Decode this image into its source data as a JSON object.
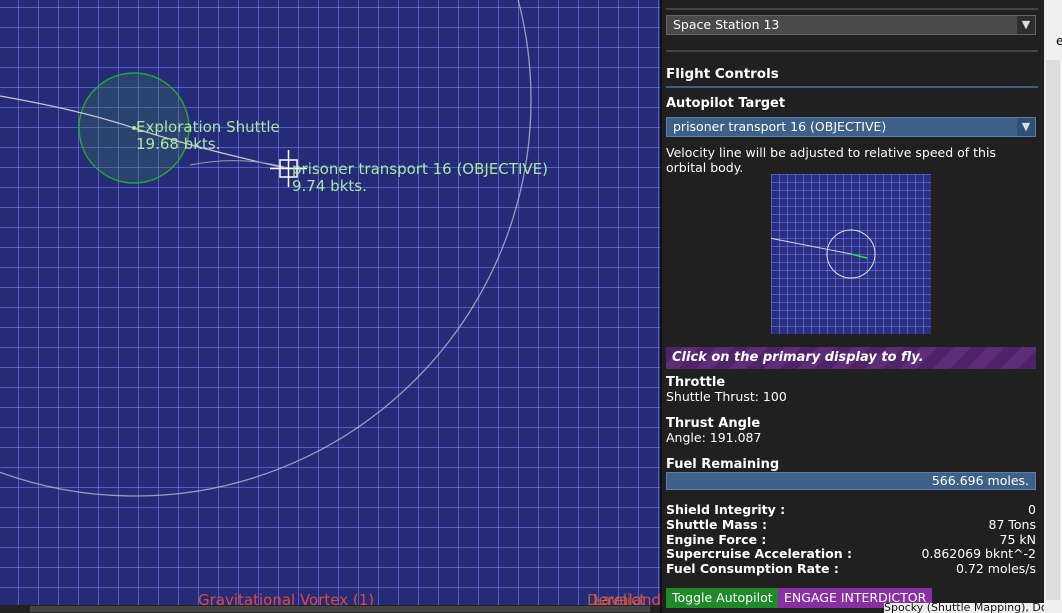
{
  "map": {
    "objects": [
      {
        "name": "Exploration Shuttle",
        "speed": "19.68 bkts."
      },
      {
        "name": "prisoner transport 16 (OBJECTIVE)",
        "speed": "9.74 bkts."
      }
    ],
    "bottom_labels": [
      {
        "text": "Gravitational Vortex (1)",
        "color": "#e0483f"
      },
      {
        "text": "Lavaland",
        "color": "#e0483f"
      },
      {
        "text": "Derelict",
        "color": "#e07030"
      }
    ]
  },
  "panel": {
    "station_select": "Space Station 13",
    "flight_controls_title": "Flight Controls",
    "autopilot_target_label": "Autopilot Target",
    "autopilot_target_value": "prisoner transport 16 (OBJECTIVE)",
    "velocity_note": "Velocity line will be adjusted to relative speed of this orbital body.",
    "notice": "Click on the primary display to fly.",
    "throttle_label": "Throttle",
    "throttle_value": "Shuttle Thrust: 100",
    "thrust_angle_label": "Thrust Angle",
    "thrust_angle_value": "Angle: 191.087",
    "fuel_label": "Fuel Remaining",
    "fuel_value": "566.696 moles.",
    "stats": [
      {
        "label": "Shield Integrity :",
        "value": "0"
      },
      {
        "label": "Shuttle Mass :",
        "value": "87 Tons"
      },
      {
        "label": "Engine Force :",
        "value": "75 kN"
      },
      {
        "label": "Supercruise Acceleration :",
        "value": "0.862069 bknt^-2"
      },
      {
        "label": "Fuel Consumption Rate :",
        "value": "0.72 moles/s"
      }
    ],
    "toggle_autopilot": "Toggle Autopilot",
    "engage_interdictor": "ENGAGE INTERDICTOR"
  },
  "edge": {
    "top_char": "e",
    "bottom_text": "Spocky (Shuttle Mapping), Doc"
  },
  "colors": {
    "map_bg": "#262b78",
    "grid": "#7887ff",
    "label_green": "#a8e8a0",
    "accent_blue": "#3e6189",
    "notice_purple": "#5e2c78"
  }
}
